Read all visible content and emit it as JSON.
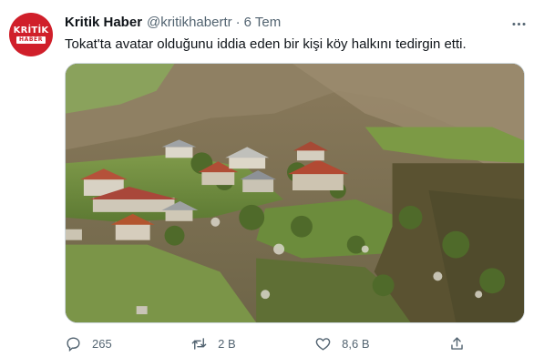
{
  "tweet": {
    "author": {
      "logo_top": "KRİTİK",
      "logo_bottom": "HABER",
      "display_name": "Kritik Haber",
      "handle": "@kritikhabertr",
      "separator": "·",
      "time": "6 Tem"
    },
    "text": "Tokat'ta avatar olduğunu iddia eden bir kişi köy halkını tedirgin etti.",
    "media": {
      "type": "photo",
      "subject": "village-hillside"
    },
    "actions": {
      "reply_count": "265",
      "retweet_count": "2 B",
      "like_count": "8,6 B"
    }
  },
  "icons": {
    "more": "more-horizontal-icon",
    "reply": "reply-icon",
    "retweet": "retweet-icon",
    "like": "heart-icon",
    "share": "share-icon"
  },
  "colors": {
    "brand_red": "#d01f2a",
    "text_primary": "#0f1419",
    "text_secondary": "#536471",
    "border": "#cfd9de"
  }
}
